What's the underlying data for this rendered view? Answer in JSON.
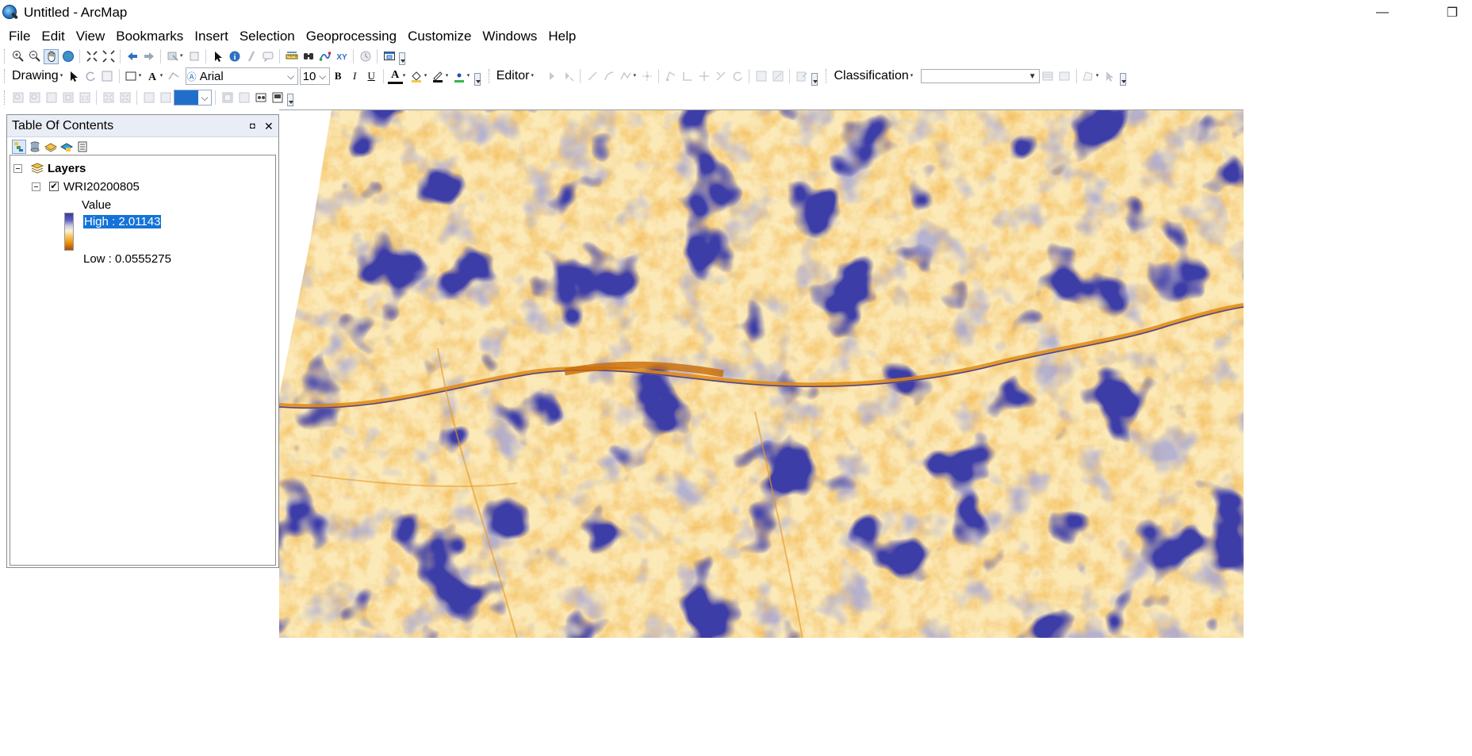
{
  "window": {
    "title": "Untitled - ArcMap",
    "minimize_glyph": "—",
    "restore_glyph": "❐"
  },
  "menu": [
    "File",
    "Edit",
    "View",
    "Bookmarks",
    "Insert",
    "Selection",
    "Geoprocessing",
    "Customize",
    "Windows",
    "Help"
  ],
  "drawing_toolbar": {
    "drawing_label": "Drawing",
    "font_name": "Arial",
    "font_size": "10",
    "bold": "B",
    "italic": "I",
    "underline": "U",
    "font_color_letter": "A"
  },
  "editor_toolbar": {
    "editor_label": "Editor"
  },
  "classification_toolbar": {
    "classification_label": "Classification",
    "combo_value": ""
  },
  "toc": {
    "title": "Table Of Contents",
    "pin_glyph": "◘",
    "close_glyph": "✕",
    "root_label": "Layers",
    "layer_name": "WRI20200805",
    "layer_checked": "✔",
    "legend_field": "Value",
    "high_label": "High : 2.01143",
    "low_label": "Low : 0.0555275"
  },
  "colors": {
    "ramp_high": "#3b3ba0",
    "ramp_mid": "#fbf4d2",
    "ramp_low": "#a94a10",
    "selection": "#1473d6"
  },
  "icons": {
    "main_tools": [
      "zoom-in-icon",
      "zoom-out-icon",
      "pan-icon",
      "full-extent-icon",
      "fixed-zoom-in-icon",
      "fixed-zoom-out-icon",
      "back-extent-icon",
      "forward-extent-icon",
      "select-features-icon",
      "clear-selection-icon",
      "select-elements-icon",
      "identify-icon",
      "hyperlink-icon",
      "html-popup-icon",
      "measure-icon",
      "find-icon",
      "find-route-icon",
      "go-to-xy-icon",
      "time-slider-icon",
      "create-viewer-window-icon"
    ]
  }
}
